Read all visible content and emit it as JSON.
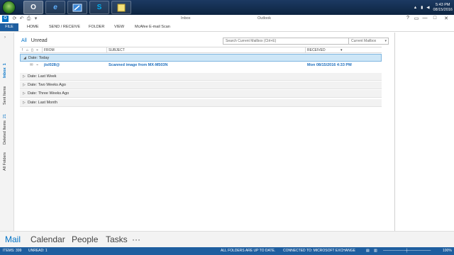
{
  "taskbar": {
    "apps": [
      "O",
      "e",
      "",
      "S",
      ""
    ],
    "clock_time": "5:43 PM",
    "clock_date": "08/15/2016"
  },
  "titlebar": {
    "folder": "Inbox",
    "app": "Outlook",
    "help": "?",
    "restore": "▭",
    "minimize": "—",
    "maximize": "□",
    "close": "✕"
  },
  "ribbon": {
    "tabs": [
      "FILE",
      "HOME",
      "SEND / RECEIVE",
      "FOLDER",
      "VIEW",
      "McAfee E-mail Scan"
    ]
  },
  "navrail": {
    "items": [
      {
        "label": "Inbox",
        "count": "1"
      },
      {
        "label": "Sent Items",
        "count": ""
      },
      {
        "label": "Deleted Items",
        "count": "21"
      },
      {
        "label": "All Folders",
        "count": ""
      }
    ]
  },
  "filters": {
    "all": "All",
    "unread": "Unread"
  },
  "search": {
    "placeholder": "Search Current Mailbox (Ctrl+E)",
    "scope": "Current Mailbox"
  },
  "columns": {
    "from": "FROM",
    "subject": "SUBJECT",
    "received": "RECEIVED"
  },
  "groups": [
    {
      "label": "Date: Today"
    },
    {
      "label": "Date: Last Week"
    },
    {
      "label": "Date: Two Weeks Ago"
    },
    {
      "label": "Date: Three Weeks Ago"
    },
    {
      "label": "Date: Last Month"
    }
  ],
  "message": {
    "from": "jisl028@",
    "subject": "Scanned image from MX-M503N",
    "received": "Mon 08/15/2016 4:33 PM"
  },
  "bottomnav": {
    "mail": "Mail",
    "calendar": "Calendar",
    "people": "People",
    "tasks": "Tasks",
    "more": "···"
  },
  "status": {
    "items": "ITEMS: 399",
    "unread": "UNREAD: 1",
    "sync": "ALL FOLDERS ARE UP TO DATE.",
    "connection": "CONNECTED TO: MICROSOFT EXCHANGE",
    "zoom": "100%"
  },
  "colors": {
    "accent": "#0072c6",
    "file_tab": "#1e5e9f",
    "selection": "#cde6f7"
  }
}
